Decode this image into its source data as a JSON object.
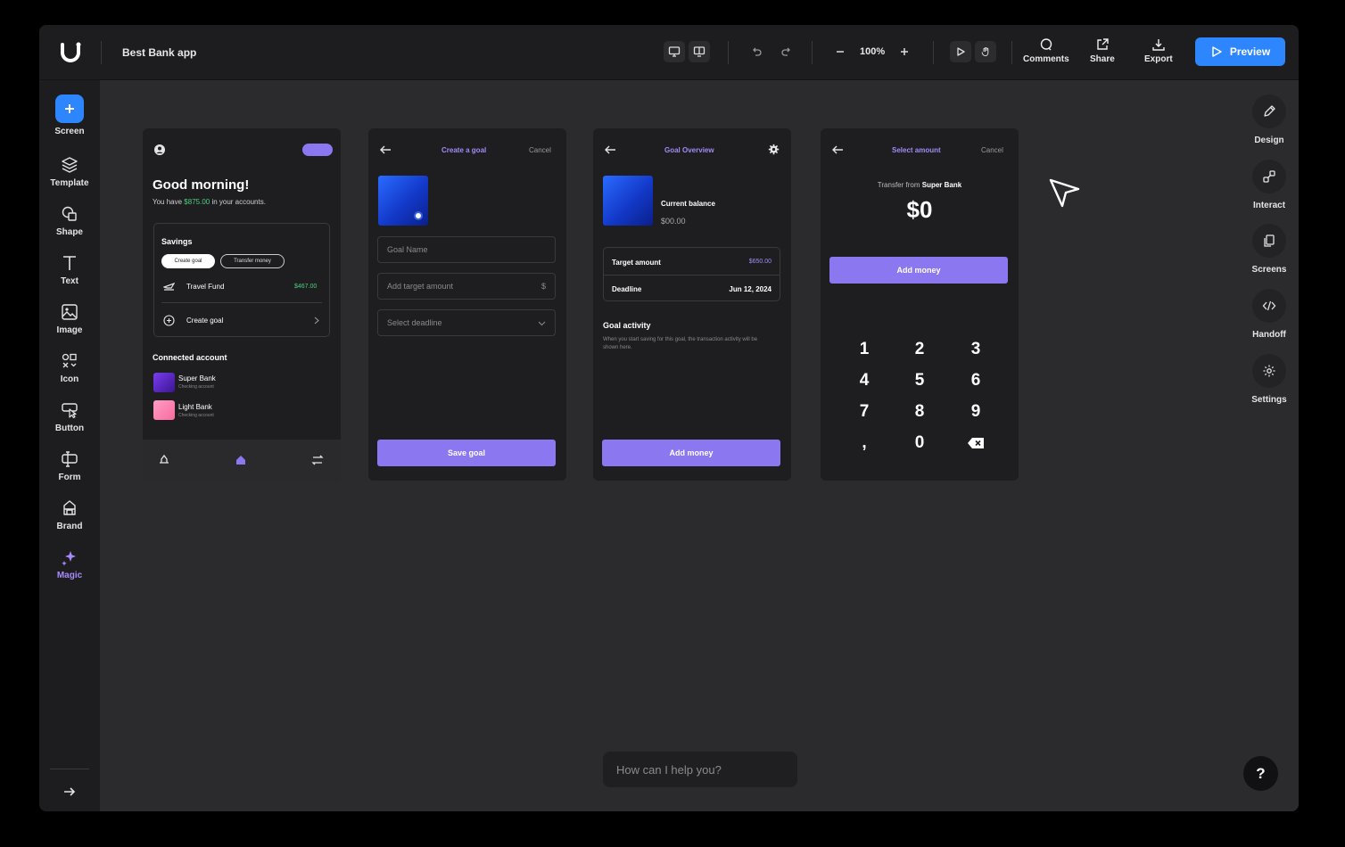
{
  "app": {
    "project_title": "Best Bank app"
  },
  "toolbar": {
    "zoom": "100%",
    "comments_label": "Comments",
    "share_label": "Share",
    "export_label": "Export",
    "preview_label": "Preview"
  },
  "left_sidebar": {
    "items": [
      {
        "label": "Screen",
        "icon": "plus-icon"
      },
      {
        "label": "Template",
        "icon": "layers-icon"
      },
      {
        "label": "Shape",
        "icon": "shape-icon"
      },
      {
        "label": "Text",
        "icon": "text-icon"
      },
      {
        "label": "Image",
        "icon": "image-icon"
      },
      {
        "label": "Icon",
        "icon": "icons-icon"
      },
      {
        "label": "Button",
        "icon": "button-icon"
      },
      {
        "label": "Form",
        "icon": "form-icon"
      },
      {
        "label": "Brand",
        "icon": "brand-icon"
      },
      {
        "label": "Magic",
        "icon": "sparkle-icon"
      }
    ]
  },
  "right_sidebar": {
    "items": [
      {
        "label": "Design",
        "icon": "pencil-icon"
      },
      {
        "label": "Interact",
        "icon": "interact-icon"
      },
      {
        "label": "Screens",
        "icon": "screens-icon"
      },
      {
        "label": "Handoff",
        "icon": "code-icon"
      },
      {
        "label": "Settings",
        "icon": "gear-icon"
      }
    ]
  },
  "screen1": {
    "greeting": "Good morning!",
    "sub_prefix": "You have ",
    "sub_amount": "$875.00",
    "sub_suffix": " in your accounts.",
    "savings_title": "Savings",
    "chip_create": "Create goal",
    "chip_transfer": "Transfer money",
    "fund_name": "Travel Fund",
    "fund_amount": "$467.00",
    "create_goal": "Create goal",
    "connected_title": "Connected account",
    "accounts": [
      {
        "name": "Super Bank",
        "type": "Checking account"
      },
      {
        "name": "Light Bank",
        "type": "Checking account"
      }
    ]
  },
  "screen2": {
    "title": "Create a goal",
    "cancel": "Cancel",
    "goal_name_placeholder": "Goal Name",
    "target_placeholder": "Add target amount",
    "currency_symbol": "$",
    "deadline_placeholder": "Select deadline",
    "save_button": "Save goal"
  },
  "screen3": {
    "title": "Goal Overview",
    "balance_label": "Current balance",
    "balance_value": "$00.00",
    "target_label": "Target amount",
    "target_value": "$650.00",
    "deadline_label": "Deadline",
    "deadline_value": "Jun 12, 2024",
    "activity_title": "Goal activity",
    "activity_desc": "When you start saving for this goal, the transaction activity will be shown here.",
    "add_button": "Add money"
  },
  "screen4": {
    "title": "Select amount",
    "cancel": "Cancel",
    "transfer_prefix": "Transfer from ",
    "transfer_bank": "Super Bank",
    "amount": "$0",
    "add_button": "Add money",
    "keys": [
      "1",
      "2",
      "3",
      "4",
      "5",
      "6",
      "7",
      "8",
      "9",
      ",",
      "0"
    ]
  },
  "assistant": {
    "placeholder": "How can I help you?",
    "help_label": "?"
  },
  "colors": {
    "accent_blue": "#2e86ff",
    "accent_purple": "#8b78f0",
    "positive_green": "#4cd07d"
  }
}
